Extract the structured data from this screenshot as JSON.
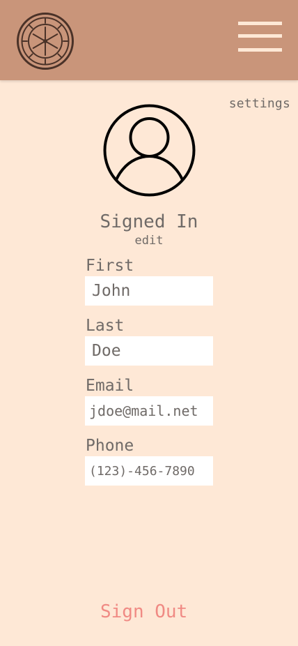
{
  "header": {
    "logo_icon": "ship-wheel-icon",
    "menu_icon": "hamburger-menu-icon",
    "background": "#c9957a"
  },
  "settings_label": "settings",
  "profile": {
    "avatar_icon": "user-avatar-icon",
    "status": "Signed In",
    "edit_label": "edit"
  },
  "fields": {
    "first": {
      "label": "First",
      "value": "John"
    },
    "last": {
      "label": "Last",
      "value": "Doe"
    },
    "email": {
      "label": "Email",
      "value": "jdoe@mail.net"
    },
    "phone": {
      "label": "Phone",
      "value": "(123)-456-7890"
    }
  },
  "sign_out_label": "Sign Out",
  "colors": {
    "page_background": "#fee8d6",
    "text": "#6f6a67",
    "sign_out": "#f08a84"
  }
}
